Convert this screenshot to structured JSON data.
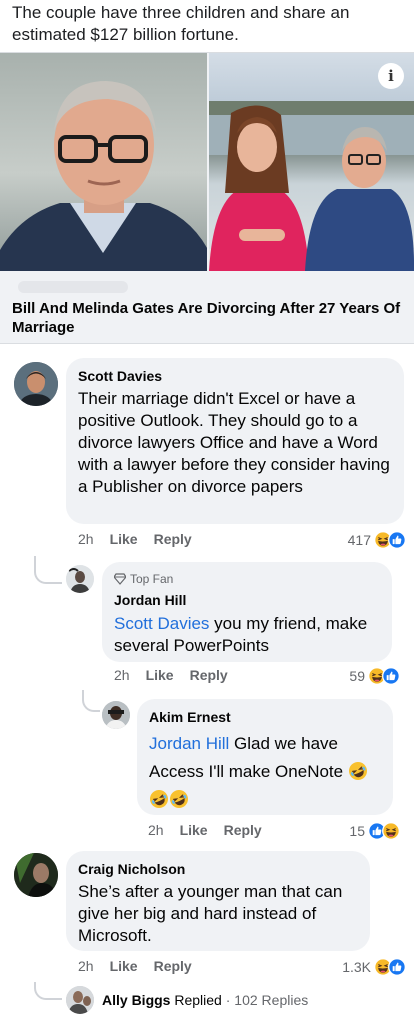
{
  "post": {
    "text": "The couple have three children and share an estimated $127 billion fortune."
  },
  "link_card": {
    "headline": "Bill And Melinda Gates Are Divorcing After 27 Years Of Marriage",
    "info_icon": "i"
  },
  "comments": [
    {
      "author": "Scott Davies",
      "text": "Their marriage didn't Excel or have a positive Outlook. They should go to a divorce lawyers Office and have a Word with a lawyer before they consider having a Publisher on divorce papers",
      "time": "2h",
      "like_label": "Like",
      "reply_label": "Reply",
      "reaction_count": "417",
      "reactions": [
        "haha-icon",
        "like-icon"
      ]
    },
    {
      "badge": "Top Fan",
      "author": "Jordan Hill",
      "mention": "Scott Davies",
      "text": " you my friend, make several PowerPoints",
      "time": "2h",
      "like_label": "Like",
      "reply_label": "Reply",
      "reaction_count": "59",
      "reactions": [
        "haha-icon",
        "like-icon"
      ]
    },
    {
      "author": "Akim Ernest",
      "mention": "Jordan Hill",
      "text": " Glad we have Access I'll make OneNote",
      "time": "2h",
      "like_label": "Like",
      "reply_label": "Reply",
      "reaction_count": "15",
      "reactions": [
        "like-icon",
        "haha-icon"
      ]
    },
    {
      "author": "Craig Nicholson",
      "text": "She’s after a younger man that can give her big and hard instead of Microsoft.",
      "time": "2h",
      "like_label": "Like",
      "reply_label": "Reply",
      "reaction_count": "1.3K",
      "reactions": [
        "haha-icon",
        "like-icon"
      ]
    }
  ],
  "replies_summary": {
    "author": "Ally Biggs",
    "action": "Replied",
    "separator": "·",
    "count": "102 Replies"
  },
  "colors": {
    "mention": "#216fdb",
    "bubble": "#f0f2f5",
    "like_blue": "#1877f2",
    "haha_yellow": "#f7b125"
  }
}
